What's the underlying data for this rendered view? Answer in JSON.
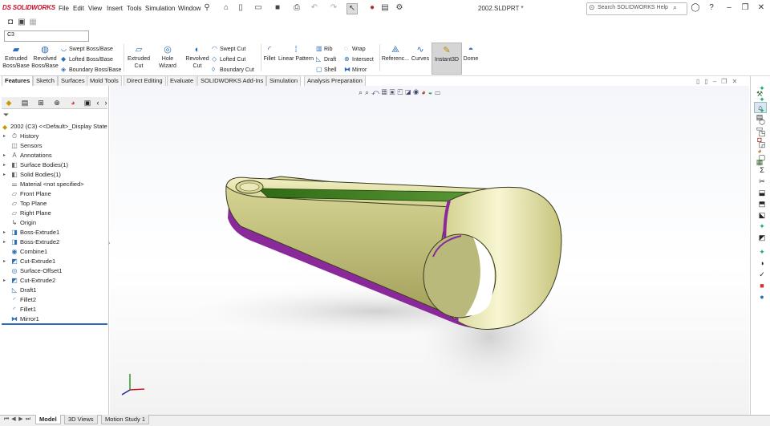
{
  "app": {
    "logo_text": "SOLIDWORKS",
    "logo_mark": "DS",
    "document_title": "2002.SLDPRT *"
  },
  "menu": [
    "File",
    "Edit",
    "View",
    "Insert",
    "Tools",
    "Simulation",
    "Window"
  ],
  "search": {
    "placeholder": "Search SOLIDWORKS Help"
  },
  "configuration": {
    "value": "C3"
  },
  "commands": {
    "extruded_boss": "Extruded Boss/Base",
    "revolved_boss": "Revolved Boss/Base",
    "swept_boss": "Swept Boss/Base",
    "lofted_boss": "Lofted Boss/Base",
    "boundary_boss": "Boundary Boss/Base",
    "extruded_cut": "Extruded Cut",
    "hole_wizard": "Hole Wizard",
    "revolved_cut": "Revolved Cut",
    "swept_cut": "Swept Cut",
    "lofted_cut": "Lofted Cut",
    "boundary_cut": "Boundary Cut",
    "fillet": "Fillet",
    "linear_pattern": "Linear Pattern",
    "rib": "Rib",
    "draft": "Draft",
    "shell": "Shell",
    "wrap": "Wrap",
    "intersect": "Intersect",
    "mirror": "Mirror",
    "reference": "Referenc...",
    "curves": "Curves",
    "instant3d": "Instant3D",
    "dome": "Dome"
  },
  "tabs": [
    "Features",
    "Sketch",
    "Surfaces",
    "Mold Tools",
    "Direct Editing",
    "Evaluate",
    "SOLIDWORKS Add-Ins",
    "Simulation",
    "Analysis Preparation"
  ],
  "tree": {
    "root": "2002 (C3) <<Default>_Display State",
    "items": [
      {
        "label": "History",
        "arrow": "▸",
        "icon": "history-icon"
      },
      {
        "label": "Sensors",
        "arrow": "",
        "icon": "sensors-icon"
      },
      {
        "label": "Annotations",
        "arrow": "▸",
        "icon": "annotations-icon"
      },
      {
        "label": "Surface Bodies(1)",
        "arrow": "▸",
        "icon": "surface-bodies-icon"
      },
      {
        "label": "Solid Bodies(1)",
        "arrow": "▸",
        "icon": "solid-bodies-icon"
      },
      {
        "label": "Material <not specified>",
        "arrow": "",
        "icon": "material-icon"
      },
      {
        "label": "Front Plane",
        "arrow": "",
        "icon": "plane-icon"
      },
      {
        "label": "Top Plane",
        "arrow": "",
        "icon": "plane-icon"
      },
      {
        "label": "Right Plane",
        "arrow": "",
        "icon": "plane-icon"
      },
      {
        "label": "Origin",
        "arrow": "",
        "icon": "origin-icon"
      },
      {
        "label": "Boss-Extrude1",
        "arrow": "▸",
        "icon": "extrude-icon"
      },
      {
        "label": "Boss-Extrude2",
        "arrow": "▸",
        "icon": "extrude-icon"
      },
      {
        "label": "Combine1",
        "arrow": "",
        "icon": "combine-icon"
      },
      {
        "label": "Cut-Extrude1",
        "arrow": "▸",
        "icon": "cut-extrude-icon"
      },
      {
        "label": "Surface-Offset1",
        "arrow": "",
        "icon": "surface-offset-icon"
      },
      {
        "label": "Cut-Extrude2",
        "arrow": "▸",
        "icon": "cut-extrude-icon"
      },
      {
        "label": "Draft1",
        "arrow": "",
        "icon": "draft-icon"
      },
      {
        "label": "Fillet2",
        "arrow": "",
        "icon": "fillet-icon"
      },
      {
        "label": "Fillet1",
        "arrow": "",
        "icon": "fillet-icon"
      },
      {
        "label": "Mirror1",
        "arrow": "",
        "icon": "mirror-icon"
      }
    ]
  },
  "bottom_tabs": [
    "Model",
    "3D Views",
    "Motion Study 1"
  ],
  "colors": {
    "accent": "#2a6ebb",
    "brand": "#c8102e",
    "part_yellow": "#e4e3a2",
    "part_green": "#2f6b14",
    "edge_purple": "#8a2a9a"
  }
}
